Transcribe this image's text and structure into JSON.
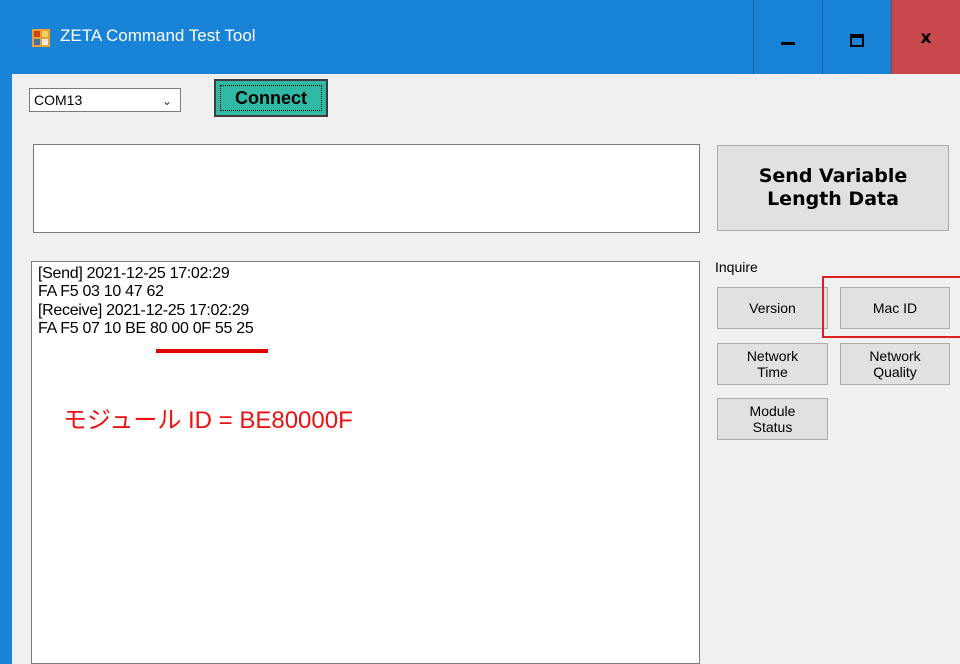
{
  "window": {
    "title": "ZETA Command Test Tool",
    "minimize_icon": "minimize-icon",
    "maximize_icon": "maximize-icon",
    "close_label": "x"
  },
  "port": {
    "selected": "COM13",
    "arrow": "⌄"
  },
  "connect_label": "Connect",
  "data_input": {
    "value": ""
  },
  "send": {
    "line1": "Send Variable",
    "line2": "Length Data"
  },
  "log": {
    "lines": [
      "[Send] 2021-12-25 17:02:29",
      "FA F5 03 10 47 62",
      "[Receive] 2021-12-25 17:02:29",
      "FA F5 07 10 BE 80 00 0F 55 25"
    ]
  },
  "annotation": {
    "module_id": "モジュール ID = BE80000F",
    "highlight_color": "#e02020"
  },
  "inquire": {
    "label": "Inquire",
    "version": "Version",
    "mac_id": "Mac ID",
    "network_time_1": "Network",
    "network_time_2": "Time",
    "network_quality_1": "Network",
    "network_quality_2": "Quality",
    "module_status_1": "Module",
    "module_status_2": "Status"
  },
  "colors": {
    "titlebar": "#1883d7",
    "connect": "#2fb9a5",
    "close": "#c8484e"
  }
}
